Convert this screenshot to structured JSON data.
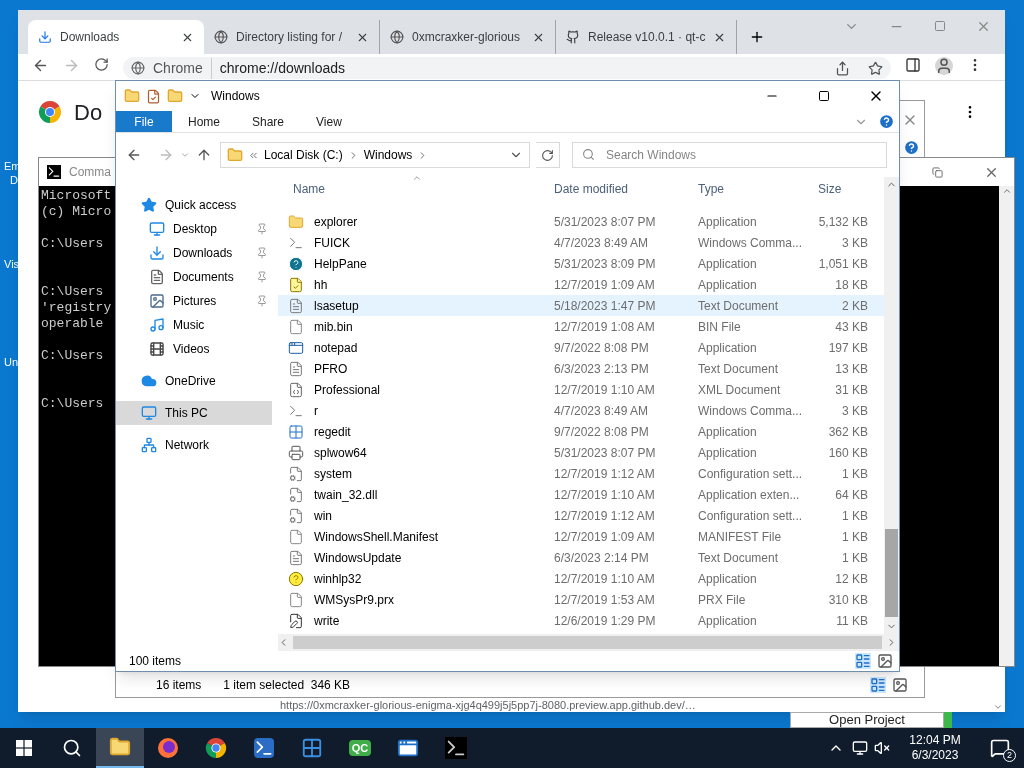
{
  "desktop": {
    "icon_labels": [
      "Em",
      "D",
      "Vis",
      "Un"
    ]
  },
  "browser": {
    "tabs": [
      {
        "title": "Downloads",
        "selected": true
      },
      {
        "title": "Directory listing for /",
        "selected": false
      },
      {
        "title": "0xmcraxker-glorious",
        "selected": false
      },
      {
        "title": "Release v10.0.1 · qt-c",
        "selected": false
      }
    ],
    "site_chip": "Chrome",
    "url": "chrome://downloads",
    "page_heading": "Do",
    "page_link": "https://0xmcraxker-glorious-enigma-xjg4q499j5j5pp7j-8080.preview.app.github.dev/…"
  },
  "back_explorer": {
    "item_count": "16 items",
    "selection": "1 item selected  346 KB"
  },
  "console": {
    "title": "Comma",
    "text": "Microsoft\n(c) Micro\n\nC:\\Users\n\n\nC:\\Users\n'registry\noperable\n\nC:\\Users\n\n\nC:\\Users"
  },
  "explorer": {
    "title": "Windows",
    "ribbon_tabs": [
      {
        "label": "File",
        "selected": true
      },
      {
        "label": "Home",
        "selected": false
      },
      {
        "label": "Share",
        "selected": false
      },
      {
        "label": "View",
        "selected": false
      }
    ],
    "path": [
      "Local Disk (C:)",
      "Windows"
    ],
    "search": {
      "placeholder": "Search Windows"
    },
    "nav": [
      {
        "label": "Quick access",
        "selected": false,
        "children": [
          {
            "label": "Desktop",
            "pinned": true,
            "selected": false
          },
          {
            "label": "Downloads",
            "pinned": true,
            "selected": false
          },
          {
            "label": "Documents",
            "pinned": true,
            "selected": false
          },
          {
            "label": "Pictures",
            "pinned": true,
            "selected": false
          },
          {
            "label": "Music",
            "pinned": false,
            "selected": false
          },
          {
            "label": "Videos",
            "pinned": false,
            "selected": false
          }
        ]
      },
      {
        "label": "OneDrive",
        "selected": false
      },
      {
        "label": "This PC",
        "selected": true
      },
      {
        "label": "Network",
        "selected": false
      }
    ],
    "columns": [
      "Name",
      "Date modified",
      "Type",
      "Size"
    ],
    "files": [
      {
        "name": "explorer",
        "date": "5/31/2023 8:07 PM",
        "type": "Application",
        "size": "5,132 KB",
        "hovered": false
      },
      {
        "name": "FUICK",
        "date": "4/7/2023 8:49 AM",
        "type": "Windows Comma...",
        "size": "3 KB",
        "hovered": false
      },
      {
        "name": "HelpPane",
        "date": "5/31/2023 8:09 PM",
        "type": "Application",
        "size": "1,051 KB",
        "hovered": false
      },
      {
        "name": "hh",
        "date": "12/7/2019 1:09 AM",
        "type": "Application",
        "size": "18 KB",
        "hovered": false
      },
      {
        "name": "lsasetup",
        "date": "5/18/2023 1:47 PM",
        "type": "Text Document",
        "size": "2 KB",
        "hovered": true
      },
      {
        "name": "mib.bin",
        "date": "12/7/2019 1:08 AM",
        "type": "BIN File",
        "size": "43 KB",
        "hovered": false
      },
      {
        "name": "notepad",
        "date": "9/7/2022 8:08 PM",
        "type": "Application",
        "size": "197 KB",
        "hovered": false
      },
      {
        "name": "PFRO",
        "date": "6/3/2023 2:13 PM",
        "type": "Text Document",
        "size": "13 KB",
        "hovered": false
      },
      {
        "name": "Professional",
        "date": "12/7/2019 1:10 AM",
        "type": "XML Document",
        "size": "31 KB",
        "hovered": false
      },
      {
        "name": "r",
        "date": "4/7/2023 8:49 AM",
        "type": "Windows Comma...",
        "size": "3 KB",
        "hovered": false
      },
      {
        "name": "regedit",
        "date": "9/7/2022 8:08 PM",
        "type": "Application",
        "size": "362 KB",
        "hovered": false
      },
      {
        "name": "splwow64",
        "date": "5/31/2023 8:07 PM",
        "type": "Application",
        "size": "160 KB",
        "hovered": false
      },
      {
        "name": "system",
        "date": "12/7/2019 1:12 AM",
        "type": "Configuration sett...",
        "size": "1 KB",
        "hovered": false
      },
      {
        "name": "twain_32.dll",
        "date": "12/7/2019 1:10 AM",
        "type": "Application exten...",
        "size": "64 KB",
        "hovered": false
      },
      {
        "name": "win",
        "date": "12/7/2019 1:12 AM",
        "type": "Configuration sett...",
        "size": "1 KB",
        "hovered": false
      },
      {
        "name": "WindowsShell.Manifest",
        "date": "12/7/2019 1:09 AM",
        "type": "MANIFEST File",
        "size": "1 KB",
        "hovered": false
      },
      {
        "name": "WindowsUpdate",
        "date": "6/3/2023 2:14 PM",
        "type": "Text Document",
        "size": "1 KB",
        "hovered": false
      },
      {
        "name": "winhlp32",
        "date": "12/7/2019 1:10 AM",
        "type": "Application",
        "size": "12 KB",
        "hovered": false
      },
      {
        "name": "WMSysPr9.prx",
        "date": "12/7/2019 1:53 AM",
        "type": "PRX File",
        "size": "310 KB",
        "hovered": false
      },
      {
        "name": "write",
        "date": "12/6/2019 1:29 PM",
        "type": "Application",
        "size": "11 KB",
        "hovered": false
      }
    ],
    "status": "100 items"
  },
  "other_window": {
    "button": "Open Project"
  },
  "taskbar": {
    "apps": [
      {
        "active": true
      },
      {
        "active": false
      },
      {
        "active": false
      },
      {
        "active": false
      },
      {
        "active": false
      },
      {
        "active": false,
        "badge": "QC"
      },
      {
        "active": false
      },
      {
        "active": false
      }
    ],
    "time": "12:04 PM",
    "date": "6/3/2023",
    "notifications": "2"
  }
}
